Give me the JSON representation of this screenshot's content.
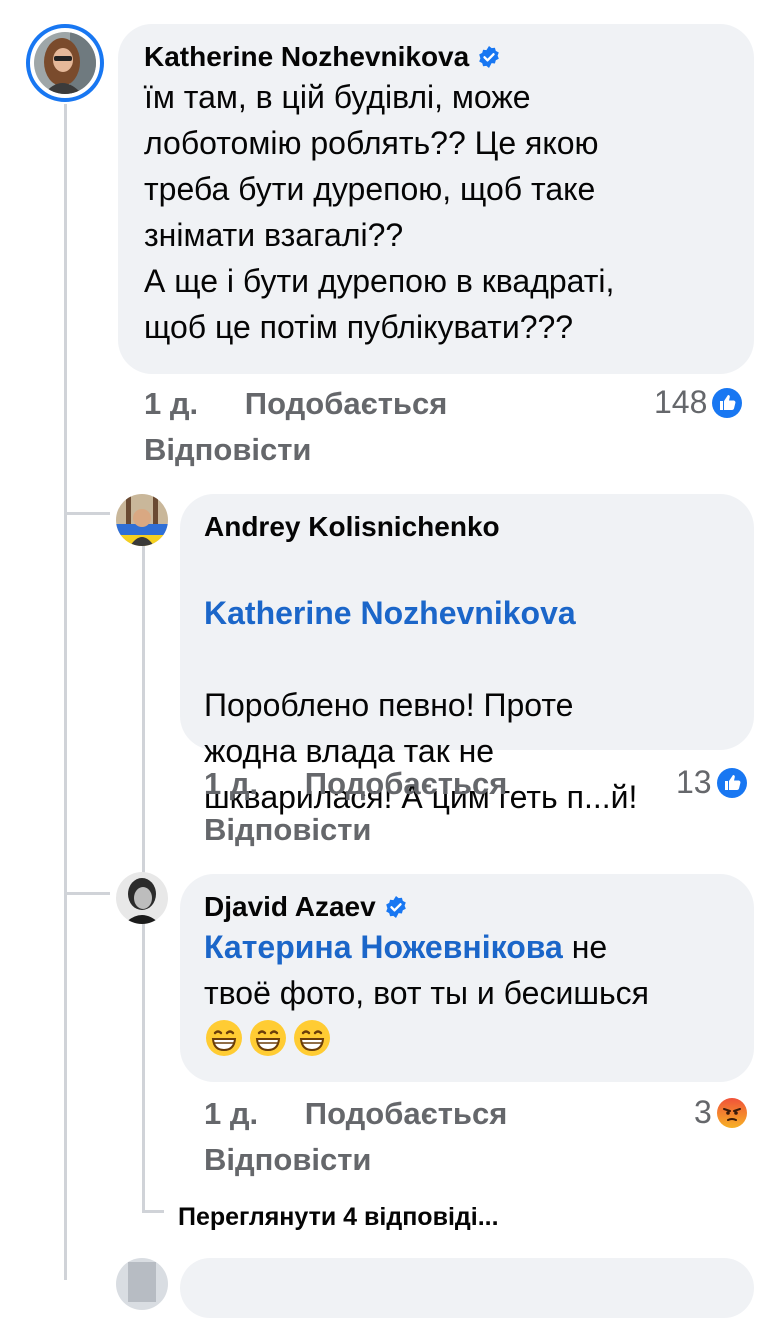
{
  "comment": {
    "author": "Katherine Nozhevnikova",
    "text": "їм там, в цій будівлі, може\nлоботомію роблять?? Це якою\nтреба бути дурепою, щоб таке\nзнімати взагалі??\nА ще  і бути дурепою в квадраті,\nщоб це потім публікувати???",
    "time": "1 д.",
    "like_label": "Подобається",
    "reply_label": "Відповісти",
    "reaction_count": "148",
    "reaction_type": "like-icon"
  },
  "replies": [
    {
      "author": "Andrey  Kolisnichenko",
      "mention": "Katherine Nozhevnikova",
      "text": "Пороблено певно! Проте\nжодна влада так не\nшкварилася! А цим геть п...й!",
      "time": "1 д.",
      "like_label": "Подобається",
      "reply_label": "Відповісти",
      "reaction_count": "13",
      "reaction_type": "like-icon"
    },
    {
      "author": "Djavid Azaev",
      "mention": "Катерина Ножевнікова",
      "text_after_mention": " не\nтвоё фото, вот ты и бесишься",
      "time": "1 д.",
      "like_label": "Подобається",
      "reply_label": "Відповісти",
      "reaction_count": "3",
      "reaction_type": "angry-icon",
      "emoji": [
        "grinning-face-icon",
        "grinning-face-icon",
        "grinning-face-icon"
      ]
    }
  ],
  "view_more": "Переглянути 4 відповіді...",
  "colors": {
    "bubble": "#f0f2f5",
    "link": "#1b66c9",
    "meta": "#65676b",
    "verified": "#1877f2"
  }
}
